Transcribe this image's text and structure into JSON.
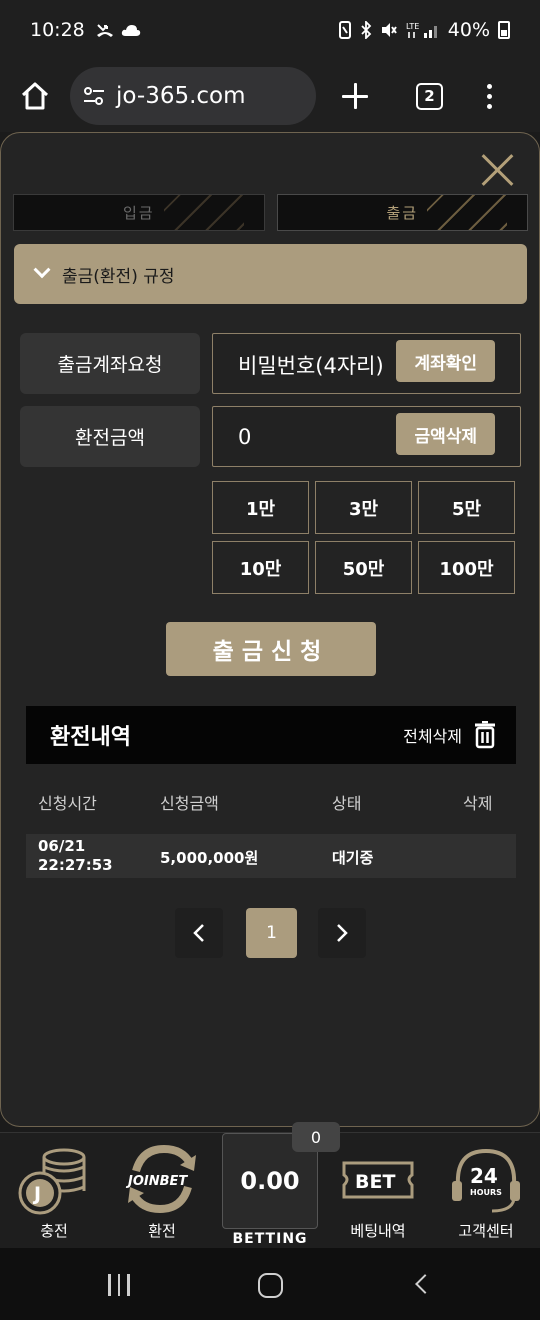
{
  "status_bar": {
    "time": "10:28",
    "battery_text": "40%"
  },
  "browser": {
    "url": "jo-365.com",
    "tab_count": "2"
  },
  "modal": {
    "tabs": [
      {
        "label": "입금",
        "active": false
      },
      {
        "label": "출금",
        "active": true
      }
    ],
    "rules_label": "출금(환전) 규정",
    "account_label": "출금계좌요청",
    "password_value": "비밀번호(4자리)",
    "check_account_button": "계좌확인",
    "amount_label": "환전금액",
    "amount_value": "0",
    "clear_amount_button": "금액삭제",
    "quick_amounts": [
      "1만",
      "3만",
      "5만",
      "10만",
      "50만",
      "100만"
    ],
    "submit_button": "출금신청"
  },
  "history": {
    "title": "환전내역",
    "delete_all": "전체삭제",
    "columns": [
      "신청시간",
      "신청금액",
      "상태",
      "삭제"
    ],
    "rows": [
      {
        "date": "06/21",
        "time": "22:27:53",
        "amount": "5,000,000원",
        "status": "대기중",
        "delete": ""
      }
    ],
    "pagination": {
      "current": "1"
    }
  },
  "bottom_nav": {
    "items": [
      "충전",
      "환전",
      "베팅내역",
      "고객센터"
    ],
    "joinbet_text": "JOINBET",
    "bet_badge_text": "BET",
    "hours_top": "24",
    "hours_bottom": "HOURS",
    "bet_amount": "0.00",
    "bet_count": "0",
    "betting_label": "BETTING"
  },
  "colors": {
    "accent": "#ab9c7e",
    "background": "#242424"
  }
}
